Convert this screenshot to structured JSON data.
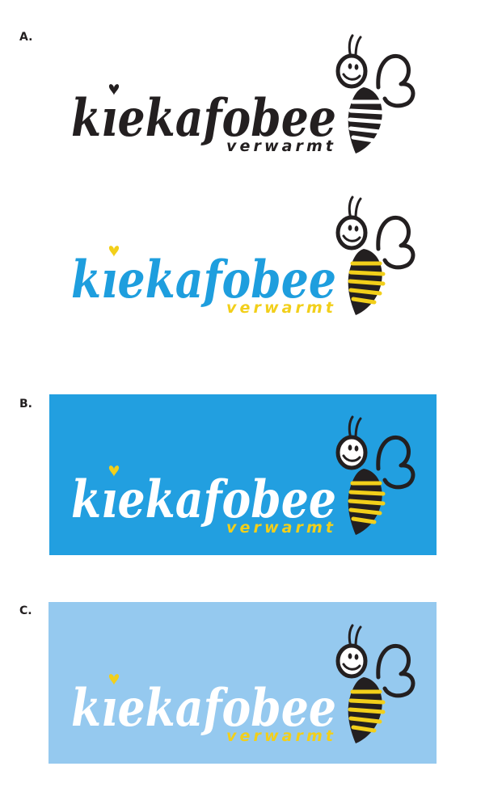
{
  "sections": [
    {
      "label": "A.",
      "variants": [
        {
          "brand": "kiekafobee",
          "tagline": "verwarmt",
          "background": "#ffffff",
          "text_color": "#231f20",
          "tagline_color": "#231f20",
          "heart_color": "#231f20",
          "bee_stripe_color": "#ffffff"
        },
        {
          "brand": "kiekafobee",
          "tagline": "verwarmt",
          "background": "#ffffff",
          "text_color": "#1e9ede",
          "tagline_color": "#f2cf1a",
          "heart_color": "#f2cf1a",
          "bee_stripe_color": "#f2cf1a"
        }
      ]
    },
    {
      "label": "B.",
      "variants": [
        {
          "brand": "kiekafobee",
          "tagline": "verwarmt",
          "background": "#229fe0",
          "text_color": "#ffffff",
          "tagline_color": "#f2cf1a",
          "heart_color": "#f2cf1a",
          "bee_stripe_color": "#f2cf1a"
        }
      ]
    },
    {
      "label": "C.",
      "variants": [
        {
          "brand": "kiekafobee",
          "tagline": "verwarmt",
          "background": "#95c9ef",
          "text_color": "#ffffff",
          "tagline_color": "#f2cf1a",
          "heart_color": "#f2cf1a",
          "bee_stripe_color": "#f2cf1a"
        }
      ]
    }
  ],
  "colors": {
    "ink": "#231f20"
  },
  "icons": [
    "heart-icon",
    "bee-icon"
  ]
}
